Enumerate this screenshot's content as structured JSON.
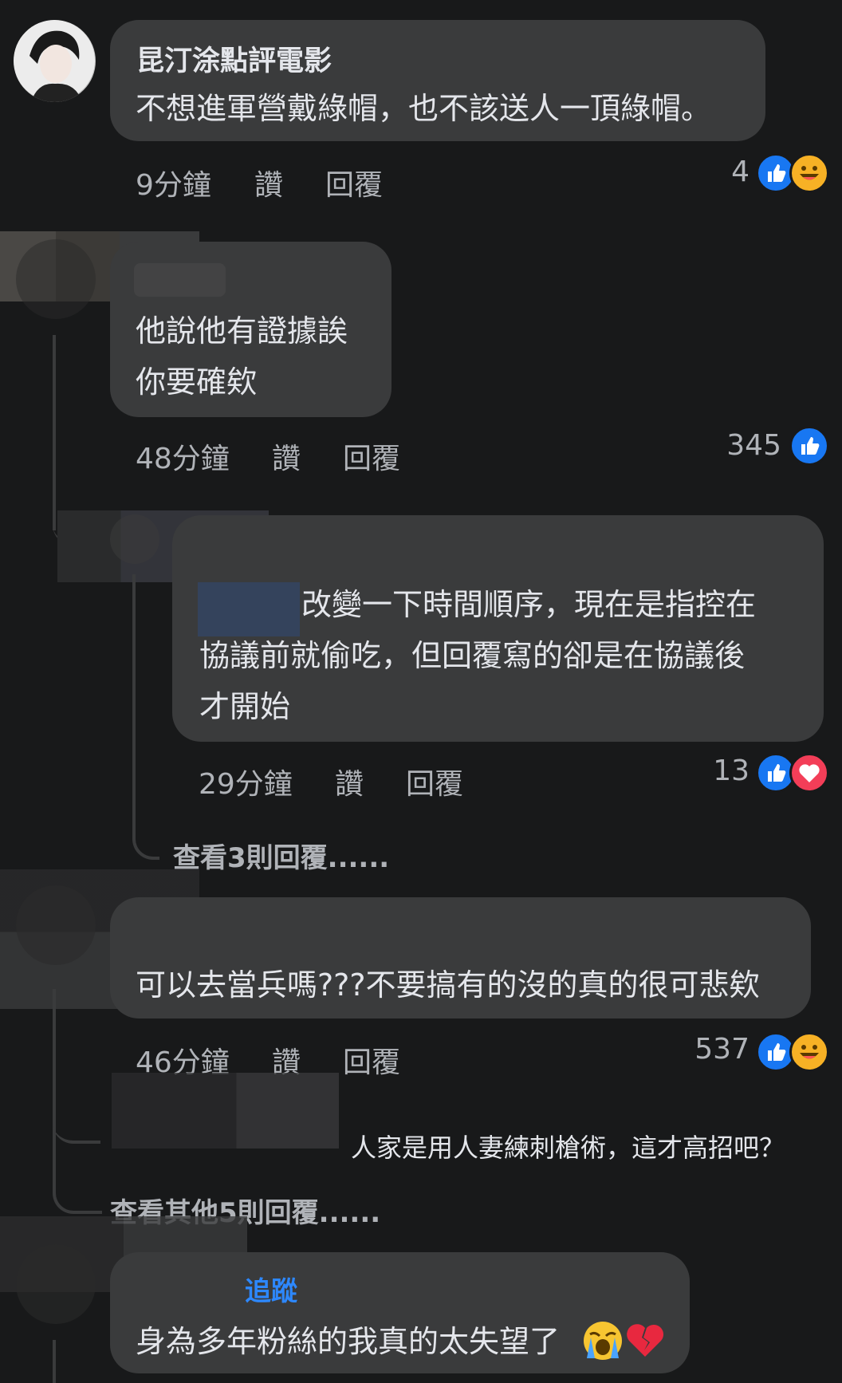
{
  "comments": [
    {
      "author": "昆汀涂點評電影",
      "lines": [
        "不想進軍營戴綠帽，也不該送人一頂綠帽。"
      ],
      "time": "9分鐘",
      "like_label": "讚",
      "reply_label": "回覆",
      "reaction_count": "4",
      "reactions": [
        "like-icon",
        "haha-icon"
      ]
    },
    {
      "author": "",
      "lines": [
        "他說他有證據誒",
        "你要確欸"
      ],
      "time": "48分鐘",
      "like_label": "讚",
      "reply_label": "回覆",
      "reaction_count": "345",
      "reactions": [
        "like-icon"
      ]
    },
    {
      "author": "",
      "lines": [
        "改變一下時間順序，現在是指控在",
        "協議前就偷吃，但回覆寫的卻是在協議後",
        "才開始"
      ],
      "time": "29分鐘",
      "like_label": "讚",
      "reply_label": "回覆",
      "reaction_count": "13",
      "reactions": [
        "like-icon",
        "love-icon"
      ],
      "view_replies": "查看3則回覆......"
    },
    {
      "author": "",
      "lines": [
        "可以去當兵嗎???不要搞有的沒的真的很可悲欸"
      ],
      "time": "46分鐘",
      "like_label": "讚",
      "reply_label": "回覆",
      "reaction_count": "537",
      "reactions": [
        "like-icon",
        "haha-icon"
      ],
      "preview_reply": "人家是用人妻練刺槍術，這才高招吧？",
      "view_replies": "查看其他5則回覆......"
    },
    {
      "author": "追蹤",
      "lines": [
        "身為多年粉絲的我真的太失望了"
      ],
      "emojis": [
        "crying-face-icon",
        "broken-heart-icon"
      ]
    }
  ],
  "colors": {
    "background": "#18191a",
    "bubble": "#3a3b3c",
    "text": "#e4e6eb",
    "secondary_text": "#b0b3b8",
    "like_blue": "#1877f2",
    "love_red": "#f33e58",
    "haha_yellow": "#f7b125",
    "follow_link": "#2d88ff"
  }
}
